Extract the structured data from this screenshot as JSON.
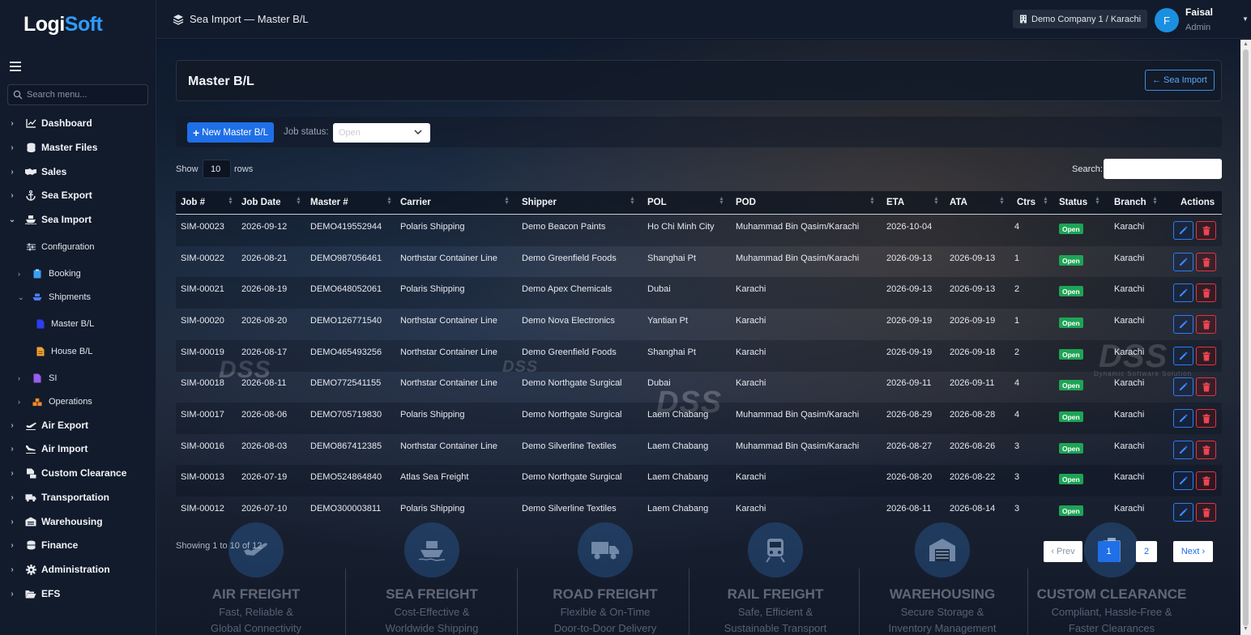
{
  "app": {
    "logo_main": "Logi",
    "logo_accent": "Soft"
  },
  "sidebar": {
    "search_placeholder": "Search menu...",
    "items": [
      {
        "label": "Dashboard",
        "icon": "chart-line-icon"
      },
      {
        "label": "Master Files",
        "icon": "database-icon"
      },
      {
        "label": "Sales",
        "icon": "handshake-icon"
      },
      {
        "label": "Sea Export",
        "icon": "anchor-icon"
      },
      {
        "label": "Sea Import",
        "icon": "ship-icon",
        "expanded": true
      },
      {
        "label": "Air Export",
        "icon": "plane-departure-icon"
      },
      {
        "label": "Air Import",
        "icon": "plane-arrival-icon"
      },
      {
        "label": "Custom Clearance",
        "icon": "file-stamp-icon"
      },
      {
        "label": "Transportation",
        "icon": "truck-icon"
      },
      {
        "label": "Warehousing",
        "icon": "warehouse-icon"
      },
      {
        "label": "Finance",
        "icon": "coins-icon"
      },
      {
        "label": "Administration",
        "icon": "gear-icon"
      },
      {
        "label": "EFS",
        "icon": "folder-open-icon"
      }
    ],
    "sea_import_children": [
      {
        "label": "Configuration",
        "icon": "sliders-icon"
      },
      {
        "label": "Booking",
        "icon": "clipboard-icon"
      },
      {
        "label": "Shipments",
        "icon": "ship-icon"
      },
      {
        "label": "Master B/L",
        "icon": "doc-blue-icon",
        "active": true
      },
      {
        "label": "House B/L",
        "icon": "doc-orange-icon"
      },
      {
        "label": "SI",
        "icon": "doc-purple-icon"
      },
      {
        "label": "Operations",
        "icon": "boxes-icon"
      }
    ]
  },
  "topbar": {
    "breadcrumb": "Sea Import — Master B/L",
    "company": "Demo Company 1 / Karachi",
    "avatar_initial": "F",
    "user_name": "Faisal",
    "user_role": "Admin"
  },
  "page": {
    "title": "Master B/L",
    "back_label": "Sea Import",
    "new_button": "New Master B/L",
    "job_status_label": "Job status:",
    "job_status_value": "Open",
    "show_label": "Show",
    "rows_per_page": "10",
    "rows_label": "rows",
    "search_label": "Search:",
    "showing_text": "Showing 1 to 10 of 12",
    "pager": {
      "prev": "‹ Prev",
      "pages": [
        "1",
        "2"
      ],
      "next": "Next ›",
      "current": "1"
    }
  },
  "watermarks": [
    "DSS",
    "DSS",
    "DSS",
    "DSS",
    "Dynamic Software Solution"
  ],
  "table": {
    "columns": [
      "Job #",
      "Job Date",
      "Master #",
      "Carrier",
      "Shipper",
      "POL",
      "POD",
      "ETA",
      "ATA",
      "Ctrs",
      "Status",
      "Branch",
      "Actions"
    ],
    "rows": [
      [
        "SIM-00023",
        "2026-09-12",
        "DEMO419552944",
        "Polaris Shipping",
        "Demo Beacon Paints",
        "Ho Chi Minh City",
        "Muhammad Bin Qasim/Karachi",
        "2026-10-04",
        "",
        "4",
        "Open",
        "Karachi"
      ],
      [
        "SIM-00022",
        "2026-08-21",
        "DEMO987056461",
        "Northstar Container Line",
        "Demo Greenfield Foods",
        "Shanghai Pt",
        "Muhammad Bin Qasim/Karachi",
        "2026-09-13",
        "2026-09-13",
        "1",
        "Open",
        "Karachi"
      ],
      [
        "SIM-00021",
        "2026-08-19",
        "DEMO648052061",
        "Polaris Shipping",
        "Demo Apex Chemicals",
        "Dubai",
        "Karachi",
        "2026-09-13",
        "2026-09-13",
        "2",
        "Open",
        "Karachi"
      ],
      [
        "SIM-00020",
        "2026-08-20",
        "DEMO126771540",
        "Northstar Container Line",
        "Demo Nova Electronics",
        "Yantian Pt",
        "Karachi",
        "2026-09-19",
        "2026-09-19",
        "1",
        "Open",
        "Karachi"
      ],
      [
        "SIM-00019",
        "2026-08-17",
        "DEMO465493256",
        "Northstar Container Line",
        "Demo Greenfield Foods",
        "Shanghai Pt",
        "Karachi",
        "2026-09-19",
        "2026-09-18",
        "2",
        "Open",
        "Karachi"
      ],
      [
        "SIM-00018",
        "2026-08-11",
        "DEMO772541155",
        "Northstar Container Line",
        "Demo Northgate Surgical",
        "Dubai",
        "Karachi",
        "2026-09-11",
        "2026-09-11",
        "4",
        "Open",
        "Karachi"
      ],
      [
        "SIM-00017",
        "2026-08-06",
        "DEMO705719830",
        "Polaris Shipping",
        "Demo Northgate Surgical",
        "Laem Chabang",
        "Muhammad Bin Qasim/Karachi",
        "2026-08-29",
        "2026-08-28",
        "4",
        "Open",
        "Karachi"
      ],
      [
        "SIM-00016",
        "2026-08-03",
        "DEMO867412385",
        "Northstar Container Line",
        "Demo Silverline Textiles",
        "Laem Chabang",
        "Muhammad Bin Qasim/Karachi",
        "2026-08-27",
        "2026-08-26",
        "3",
        "Open",
        "Karachi"
      ],
      [
        "SIM-00013",
        "2026-07-19",
        "DEMO524864840",
        "Atlas Sea Freight",
        "Demo Northgate Surgical",
        "Laem Chabang",
        "Karachi",
        "2026-08-20",
        "2026-08-22",
        "3",
        "Open",
        "Karachi"
      ],
      [
        "SIM-00012",
        "2026-07-10",
        "DEMO300003811",
        "Polaris Shipping",
        "Demo Silverline Textiles",
        "Laem Chabang",
        "Karachi",
        "2026-08-11",
        "2026-08-14",
        "3",
        "Open",
        "Karachi"
      ]
    ]
  },
  "features": [
    {
      "title": "AIR FREIGHT",
      "desc1": "Fast, Reliable &",
      "desc2": "Global Connectivity",
      "icon": "plane-icon"
    },
    {
      "title": "SEA FREIGHT",
      "desc1": "Cost-Effective &",
      "desc2": "Worldwide Shipping",
      "icon": "ship-icon"
    },
    {
      "title": "ROAD FREIGHT",
      "desc1": "Flexible & On-Time",
      "desc2": "Door-to-Door Delivery",
      "icon": "truck-icon"
    },
    {
      "title": "RAIL FREIGHT",
      "desc1": "Safe, Efficient &",
      "desc2": "Sustainable Transport",
      "icon": "train-icon"
    },
    {
      "title": "WAREHOUSING",
      "desc1": "Secure Storage &",
      "desc2": "Inventory Management",
      "icon": "warehouse-icon"
    },
    {
      "title": "CUSTOM CLEARANCE",
      "desc1": "Compliant, Hassle-Free &",
      "desc2": "Faster Clearances",
      "icon": "clipboard-check-icon"
    }
  ],
  "colors": {
    "accent": "#1e6fe8",
    "status_open": "#1ea455",
    "danger": "#e3343f",
    "sidebar_bg": "#121b2b"
  }
}
